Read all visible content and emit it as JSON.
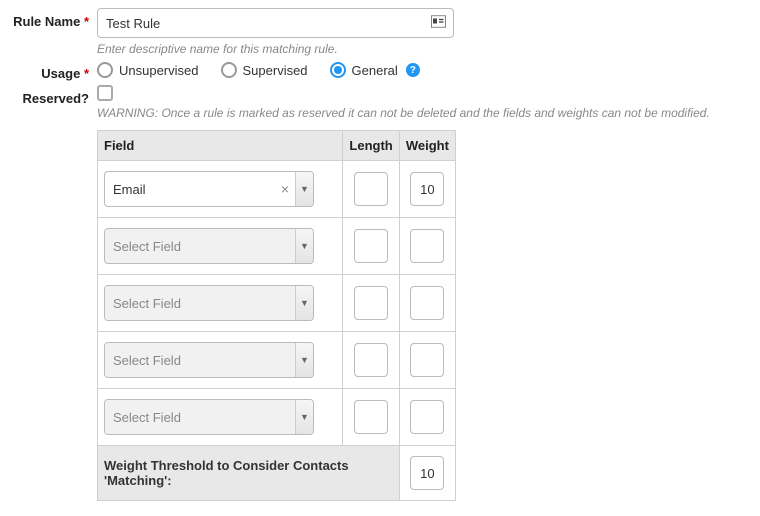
{
  "labels": {
    "rule_name": "Rule Name",
    "usage": "Usage",
    "reserved": "Reserved?",
    "required": "*"
  },
  "rule_name": {
    "value": "Test Rule",
    "helper": "Enter descriptive name for this matching rule."
  },
  "usage": {
    "options": [
      {
        "label": "Unsupervised",
        "selected": false
      },
      {
        "label": "Supervised",
        "selected": false
      },
      {
        "label": "General",
        "selected": true
      }
    ]
  },
  "reserved": {
    "checked": false,
    "warning": "WARNING: Once a rule is marked as reserved it can not be deleted and the fields and weights can not be modified."
  },
  "table": {
    "headers": {
      "field": "Field",
      "length": "Length",
      "weight": "Weight"
    },
    "rows": [
      {
        "field": "Email",
        "placeholder": false,
        "length": "",
        "weight": "10"
      },
      {
        "field": "Select Field",
        "placeholder": true,
        "length": "",
        "weight": ""
      },
      {
        "field": "Select Field",
        "placeholder": true,
        "length": "",
        "weight": ""
      },
      {
        "field": "Select Field",
        "placeholder": true,
        "length": "",
        "weight": ""
      },
      {
        "field": "Select Field",
        "placeholder": true,
        "length": "",
        "weight": ""
      }
    ],
    "threshold_label": "Weight Threshold to Consider Contacts 'Matching':",
    "threshold_value": "10"
  }
}
